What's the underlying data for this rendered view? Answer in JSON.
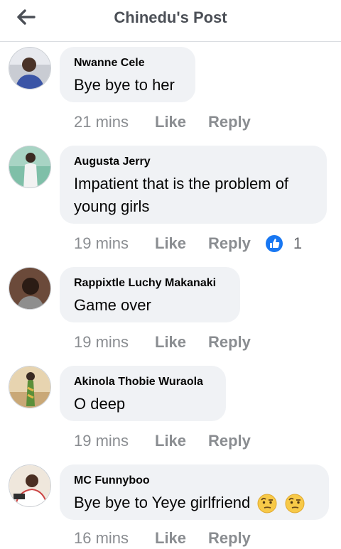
{
  "header": {
    "title": "Chinedu's Post",
    "back_icon": "arrow-left-icon"
  },
  "comments": [
    {
      "author": "Nwanne Cele",
      "text": "Bye bye to her",
      "time": "21 mins",
      "like_label": "Like",
      "reply_label": "Reply"
    },
    {
      "author": "Augusta Jerry",
      "text": "Impatient that is the problem of young girls",
      "time": "19 mins",
      "like_label": "Like",
      "reply_label": "Reply",
      "reaction_icon": "like-reaction-icon",
      "reaction_count": "1"
    },
    {
      "author": "Rappixtle Luchy Makanaki",
      "text": "Game over",
      "time": "19 mins",
      "like_label": "Like",
      "reply_label": "Reply"
    },
    {
      "author": "Akinola Thobie Wuraola",
      "text": "O deep",
      "time": "19 mins",
      "like_label": "Like",
      "reply_label": "Reply"
    },
    {
      "author": "MC Funnyboo",
      "text": "Bye bye to Yeye girlfriend",
      "emoji": [
        "raised-eyebrow-face-icon",
        "raised-eyebrow-face-icon"
      ],
      "time": "16 mins",
      "like_label": "Like",
      "reply_label": "Reply"
    }
  ],
  "colors": {
    "bubble": "#f0f2f5",
    "meta_text": "#8a8d91",
    "like_blue": "#1877f2"
  }
}
